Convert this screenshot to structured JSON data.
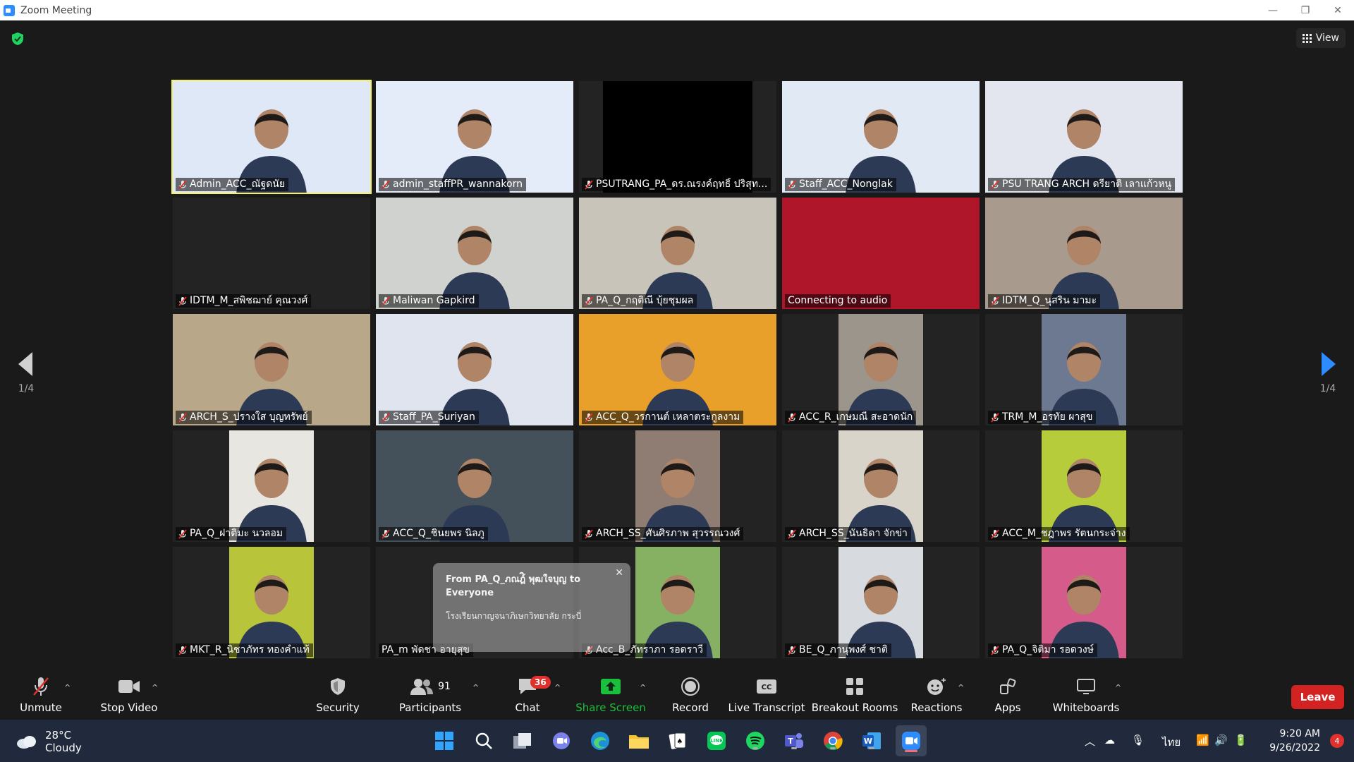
{
  "window": {
    "title": "Zoom Meeting"
  },
  "top": {
    "view_label": "View"
  },
  "pager": {
    "left": "1/4",
    "right": "1/4"
  },
  "participants_grid": [
    {
      "name": "Admin_ACC_ณัฐดนัย",
      "bg": "#dfe8f7",
      "person": true,
      "active": true
    },
    {
      "name": "admin_staffPR_wannakorn",
      "bg": "#e3ecf8",
      "person": true
    },
    {
      "name": "PSUTRANG_PA_ดร.ณรงค์ฤทธิ์ ปริสุท...",
      "bg": "#000000",
      "person": false
    },
    {
      "name": "Staff_ACC_Nonglak",
      "bg": "#e1e9f5",
      "person": true
    },
    {
      "name": "PSU TRANG ARCH ดรียาติ เลาแก้วหนู",
      "bg": "#e3e6ee",
      "person": true
    },
    {
      "name": "IDTM_M_สพิชฌาย์ คุณวงศ์",
      "bg": "#232323",
      "person": false
    },
    {
      "name": "Maliwan Gapkird",
      "bg": "#cfd2cf",
      "person": true
    },
    {
      "name": "PA_Q_กฤติณี บุ้ยชุมผล",
      "bg": "#c9c4b9",
      "person": true
    },
    {
      "name": "Connecting to audio",
      "bg": "#b0162a",
      "person": false,
      "noMic": true
    },
    {
      "name": "IDTM_Q_นุสริน มามะ",
      "bg": "#a89a8c",
      "person": true
    },
    {
      "name": "ARCH_S_ปรางใส บุญทรัพย์",
      "bg": "#b9a78a",
      "person": true
    },
    {
      "name": "Staff_PA_Suriyan",
      "bg": "#e0e4ef",
      "person": true
    },
    {
      "name": "ACC_Q_วรกานต์ เหลาตระกูลงาม",
      "bg": "#e9a02a",
      "person": true
    },
    {
      "name": "ACC_R_เกษมณี สะอาดนัก",
      "bg": "#9c958b",
      "person": true,
      "narrow": true
    },
    {
      "name": "TRM_M_อรทัย ผาสุข",
      "bg": "#6d7991",
      "person": true,
      "narrow": true
    },
    {
      "name": "PA_Q_ฝาติมะ นวลอม",
      "bg": "#e8e6e0",
      "person": true,
      "narrow": true
    },
    {
      "name": "ACC_Q_ชินยพร นิลภู",
      "bg": "#44505a",
      "person": true
    },
    {
      "name": "ARCH_SS_ศันศิรภาพ สุวรรณวงศ์",
      "bg": "#8f7c72",
      "person": true,
      "narrow": true
    },
    {
      "name": "ARCH_SS_นันธิดา จักข่า",
      "bg": "#d8d4c9",
      "person": true,
      "narrow": true
    },
    {
      "name": "ACC_M_ชฎาพร รัตนกระจ่าง",
      "bg": "#b7cc3a",
      "person": true,
      "narrow": true
    },
    {
      "name": "MKT_R_นิชาภัทร ทองคำแท้",
      "bg": "#b8c43a",
      "person": true,
      "narrow": true
    },
    {
      "name": "PA_m พัดชา อายุสุข",
      "bg": "#232323",
      "person": false,
      "noMic": true
    },
    {
      "name": "Acc_B_ภัทราภา รอดราวี",
      "bg": "#86b062",
      "person": true,
      "narrow": true
    },
    {
      "name": "BE_Q_ภานุพงศ์ ชาติ",
      "bg": "#d7dbe0",
      "person": true,
      "narrow": true
    },
    {
      "name": "PA_Q_จิติมา รอดวงษ์",
      "bg": "#d55c8a",
      "person": true,
      "narrow": true
    }
  ],
  "chat_popup": {
    "from": "From PA_Q_ภณฎ์ิ พุฒใจบุญ to Everyone",
    "message": "โรงเรียนกาญจนาภิเษกวิทยาลัย กระบี่"
  },
  "controls": {
    "unmute": "Unmute",
    "stop_video": "Stop Video",
    "security": "Security",
    "participants": "Participants",
    "participants_count": "91",
    "chat": "Chat",
    "chat_badge": "36",
    "share_screen": "Share Screen",
    "record": "Record",
    "live_transcript": "Live Transcript",
    "breakout_rooms": "Breakout Rooms",
    "reactions": "Reactions",
    "apps": "Apps",
    "whiteboards": "Whiteboards",
    "leave": "Leave",
    "accent": "#2d8cff",
    "share_green": "#1cbe3d"
  },
  "taskbar": {
    "temperature": "28°C",
    "condition": "Cloudy",
    "language": "ไทย",
    "time": "9:20 AM",
    "date": "9/26/2022",
    "notifications": "4"
  }
}
